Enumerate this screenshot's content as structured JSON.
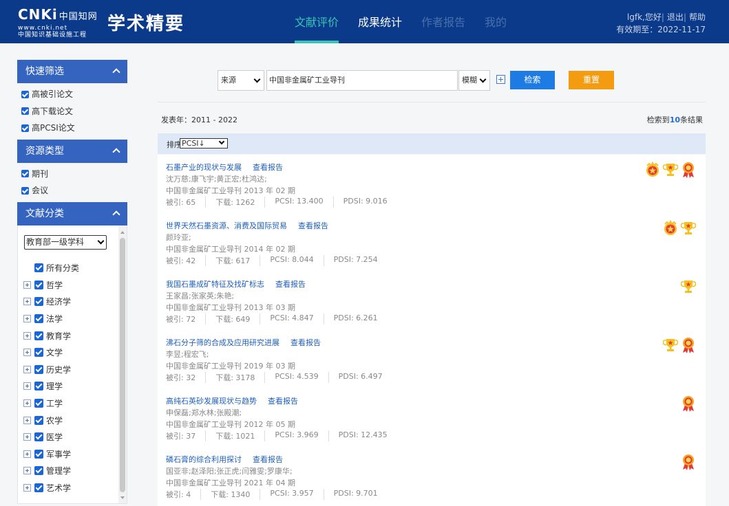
{
  "header": {
    "logo_main": "CNKi",
    "logo_cn": "中国知网",
    "logo_url": "www.cnki.net",
    "logo_sub": "中国知识基础设施工程",
    "brand": "学术精要",
    "nav": [
      {
        "label": "文献评价",
        "state": "active"
      },
      {
        "label": "成果统计",
        "state": "normal"
      },
      {
        "label": "作者报告",
        "state": "disabled"
      },
      {
        "label": "我的",
        "state": "disabled"
      }
    ],
    "user_greeting": "lgfk,您好",
    "logout": "退出",
    "help": "帮助",
    "expiry": "有效期至：2022-11-17"
  },
  "sidebar": {
    "quick_filter": {
      "title": "快速筛选",
      "items": [
        "高被引论文",
        "高下载论文",
        "高PCSI论文"
      ]
    },
    "resource_type": {
      "title": "资源类型",
      "items": [
        "期刊",
        "会议"
      ]
    },
    "classification": {
      "title": "文献分类",
      "select_value": "教育部一级学科",
      "all_label": "所有分类",
      "items": [
        "哲学",
        "经济学",
        "法学",
        "教育学",
        "文学",
        "历史学",
        "理学",
        "工学",
        "农学",
        "医学",
        "军事学",
        "管理学",
        "艺术学"
      ]
    }
  },
  "search": {
    "field": "来源",
    "query": "中国非金属矿工业导刊",
    "mode": "模糊",
    "search_btn": "检索",
    "reset_btn": "重置"
  },
  "summary": {
    "year_range": "发表年：2011 - 2022",
    "count_prefix": "检索到",
    "count": "10",
    "count_suffix": "条结果"
  },
  "sort": {
    "label": "排序",
    "value": "PCSI↓"
  },
  "results": [
    {
      "title": "石墨产业的现状与发展",
      "report": "查看报告",
      "authors": "沈万慈;康飞宇;黄正宏;杜鸿达;",
      "source": "中国非金属矿工业导刊 2013 年 02 期",
      "cited": "被引: 65",
      "downloads": "下载: 1262",
      "pcsi": "PCSI: 13.400",
      "pdsi": "PDSI: 9.016",
      "badges": [
        "star-badge-icon",
        "trophy-icon",
        "medal-icon"
      ]
    },
    {
      "title": "世界天然石墨资源、消费及国际贸易",
      "report": "查看报告",
      "authors": "颜玲亚;",
      "source": "中国非金属矿工业导刊 2014 年 02 期",
      "cited": "被引: 42",
      "downloads": "下载: 617",
      "pcsi": "PCSI: 8.044",
      "pdsi": "PDSI: 7.254",
      "badges": [
        "star-badge-icon",
        "trophy-icon"
      ]
    },
    {
      "title": "我国石墨成矿特征及找矿标志",
      "report": "查看报告",
      "authors": "王家昌;张家英;朱艳;",
      "source": "中国非金属矿工业导刊 2013 年 03 期",
      "cited": "被引: 72",
      "downloads": "下载: 649",
      "pcsi": "PCSI: 4.847",
      "pdsi": "PDSI: 6.261",
      "badges": [
        "trophy-icon"
      ]
    },
    {
      "title": "沸石分子筛的合成及应用研究进展",
      "report": "查看报告",
      "authors": "李昱;程宏飞;",
      "source": "中国非金属矿工业导刊 2019 年 03 期",
      "cited": "被引: 32",
      "downloads": "下载: 3178",
      "pcsi": "PCSI: 4.539",
      "pdsi": "PDSI: 6.497",
      "badges": [
        "trophy-icon",
        "medal-icon"
      ]
    },
    {
      "title": "高纯石英砂发展现状与趋势",
      "report": "查看报告",
      "authors": "申保磊;郑水林;张殿潮;",
      "source": "中国非金属矿工业导刊 2012 年 05 期",
      "cited": "被引: 37",
      "downloads": "下载: 1021",
      "pcsi": "PCSI: 3.969",
      "pdsi": "PDSI: 12.435",
      "badges": [
        "medal-icon"
      ]
    },
    {
      "title": "磷石膏的综合利用探讨",
      "report": "查看报告",
      "authors": "国亚非;赵泽阳;张正虎;闫雅雯;罗康华;",
      "source": "中国非金属矿工业导刊 2021 年 04 期",
      "cited": "被引: 4",
      "downloads": "下载: 1340",
      "pcsi": "PCSI: 3.957",
      "pdsi": "PDSI: 9.701",
      "badges": [
        "medal-icon"
      ]
    }
  ],
  "colors": {
    "header_bg": "#0b3a8a",
    "accent": "#37c6b6",
    "sidebar_head": "#3564c0",
    "search_btn": "#1e7be3",
    "reset_btn": "#f39c12",
    "link": "#1e5fbf"
  }
}
